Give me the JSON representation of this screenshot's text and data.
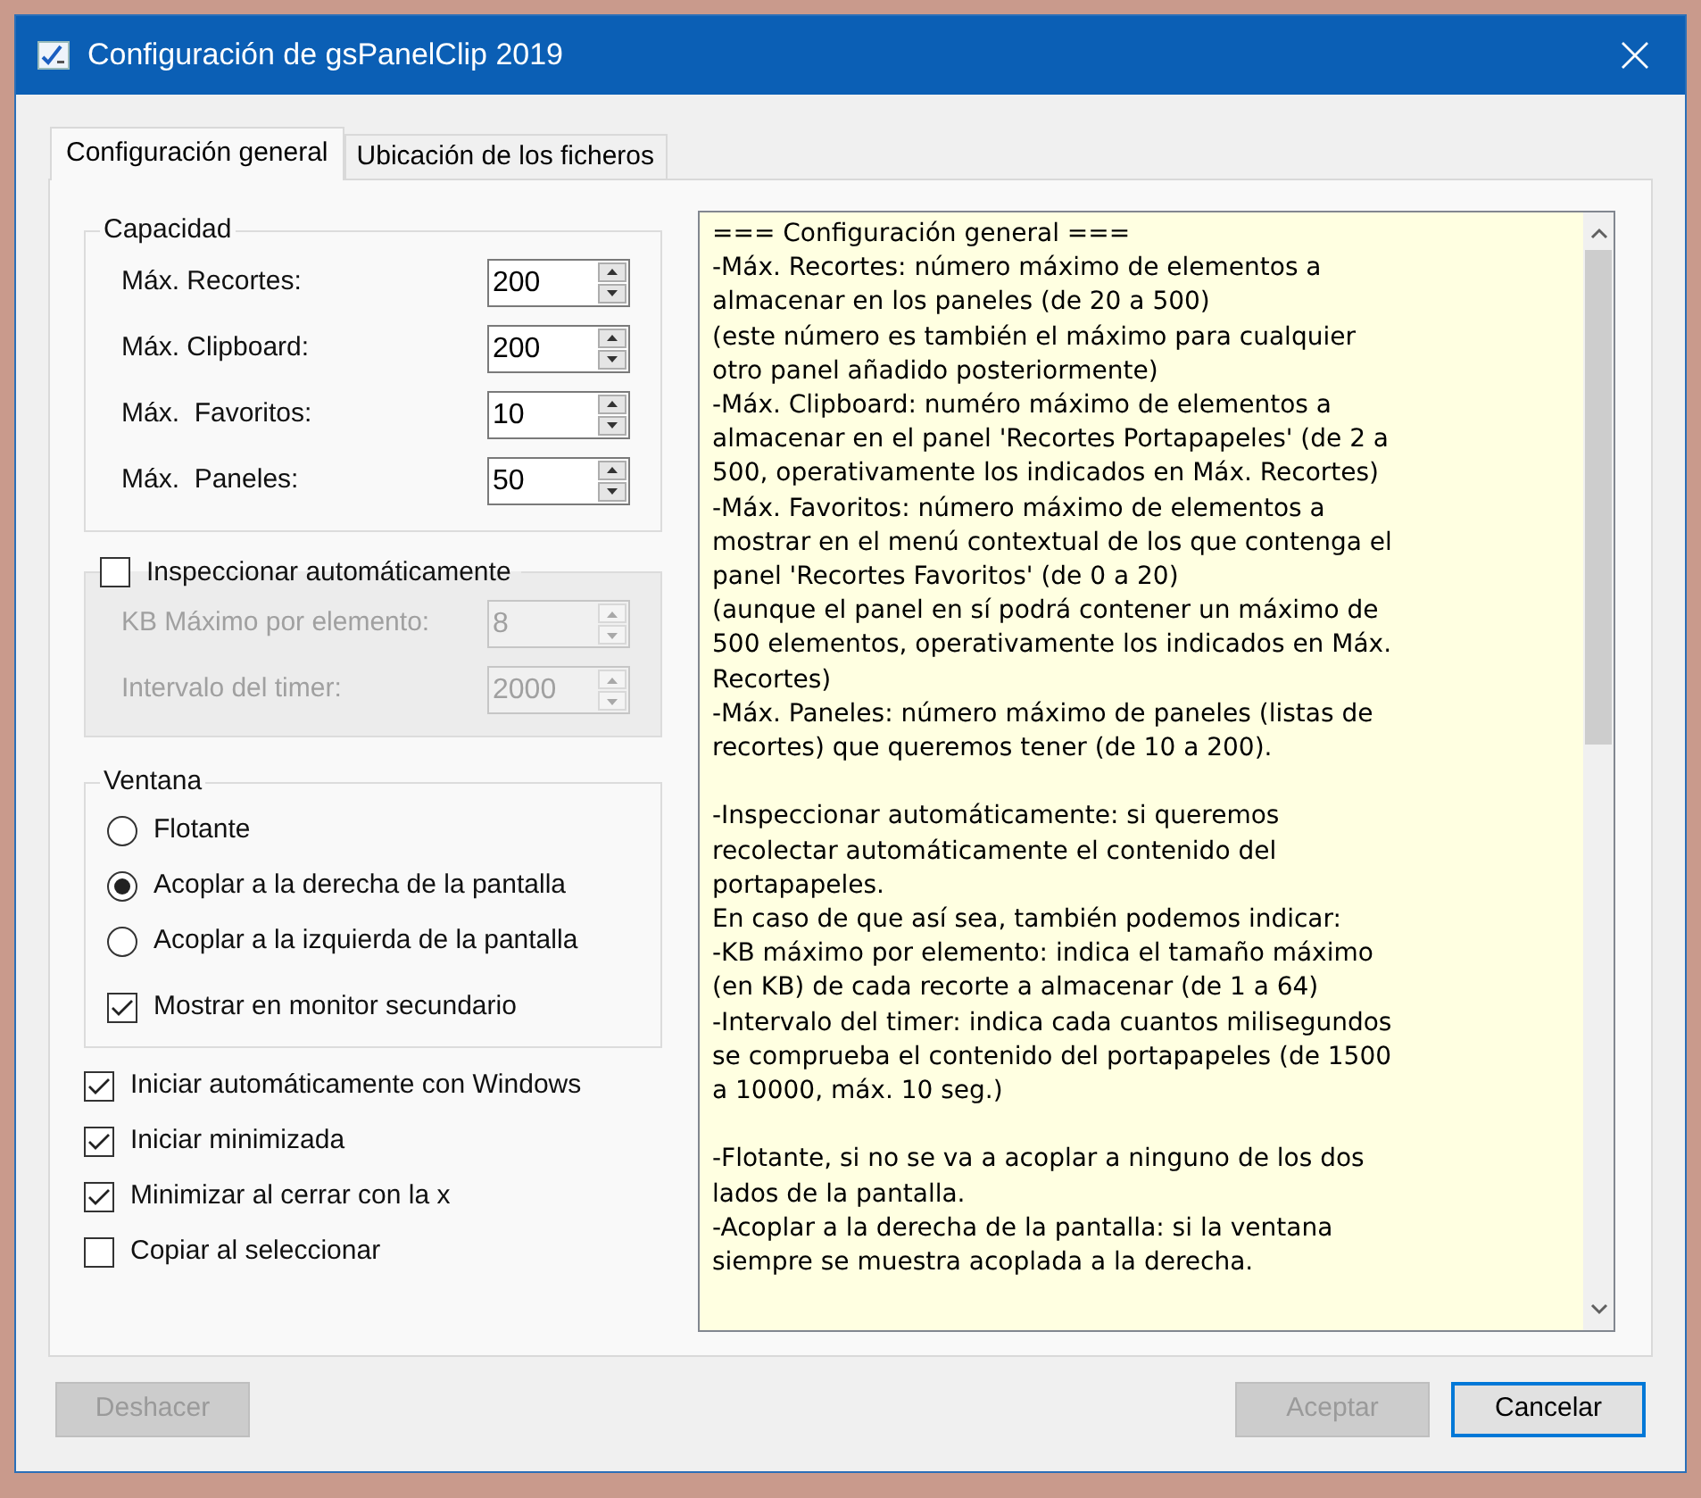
{
  "window": {
    "title": "Configuración de gsPanelClip 2019"
  },
  "tabs": [
    {
      "label": "Configuración general",
      "selected": true
    },
    {
      "label": "Ubicación de los ficheros",
      "selected": false
    }
  ],
  "capacity": {
    "title": "Capacidad",
    "fields": [
      {
        "label": "Máx. Recortes:",
        "value": "200",
        "disabled": false
      },
      {
        "label": "Máx. Clipboard:",
        "value": "200",
        "disabled": false
      },
      {
        "label": "Máx.  Favoritos:",
        "value": "10",
        "disabled": false
      },
      {
        "label": "Máx.  Paneles:",
        "value": "50",
        "disabled": false
      }
    ]
  },
  "inspect": {
    "label": "Inspeccionar automáticamente",
    "checked": false,
    "fields": [
      {
        "label": "KB Máximo por elemento:",
        "value": "8",
        "disabled": true
      },
      {
        "label": "Intervalo del timer:",
        "value": "2000",
        "disabled": true
      }
    ]
  },
  "window_group": {
    "title": "Ventana",
    "options": [
      {
        "label": "Flotante",
        "selected": false
      },
      {
        "label": "Acoplar a la derecha de la pantalla",
        "selected": true
      },
      {
        "label": "Acoplar a la izquierda de la pantalla",
        "selected": false
      }
    ],
    "checkbox": {
      "label": "Mostrar en monitor secundario",
      "checked": true
    }
  },
  "options": [
    {
      "label": "Iniciar automáticamente con Windows",
      "checked": true
    },
    {
      "label": "Iniciar minimizada",
      "checked": true
    },
    {
      "label": "Minimizar al cerrar con la x",
      "checked": true
    },
    {
      "label": "Copiar al seleccionar",
      "checked": false
    }
  ],
  "help_text": {
    "paragraphs": [
      [
        "=== Configuración general ===",
        "-Máx. Recortes: número máximo de elementos a",
        "almacenar en los paneles (de 20 a 500)",
        "(este número es también el máximo para cualquier",
        "otro panel añadido posteriormente)",
        "-Máx. Clipboard: numéro máximo de elementos a",
        "almacenar en el panel 'Recortes Portapapeles' (de 2 a",
        "500, operativamente los indicados en Máx. Recortes)",
        "-Máx. Favoritos: número máximo de elementos a",
        "mostrar en el menú contextual de los que contenga el",
        "panel 'Recortes Favoritos' (de 0 a 20)",
        "(aunque el panel en sí podrá contener un máximo de",
        "500 elementos, operativamente los indicados en Máx.",
        "Recortes)",
        "-Máx. Paneles: número máximo de paneles (listas de",
        "recortes) que queremos tener (de 10 a 200)."
      ],
      [
        "-Inspeccionar automáticamente: si queremos",
        "recolectar automáticamente el contenido del",
        "portapapeles.",
        "En caso de que así sea, también podemos indicar:",
        "-KB máximo por elemento: indica el tamaño máximo",
        "(en KB) de cada recorte a almacenar (de 1 a 64)",
        "-Intervalo del timer: indica cada cuantos milisegundos",
        "se comprueba el contenido del portapapeles (de 1500",
        "a 10000, máx. 10 seg.)"
      ],
      [
        "-Flotante, si no se va a acoplar a ninguno de los dos",
        "lados de la pantalla.",
        "-Acoplar a la derecha de la pantalla: si la ventana",
        "siempre se muestra acoplada a la derecha."
      ]
    ]
  },
  "buttons": [
    {
      "label": "Deshacer",
      "disabled": true,
      "focused": false
    },
    {
      "label": "Aceptar",
      "disabled": true,
      "focused": false
    },
    {
      "label": "Cancelar",
      "disabled": false,
      "focused": true
    }
  ]
}
